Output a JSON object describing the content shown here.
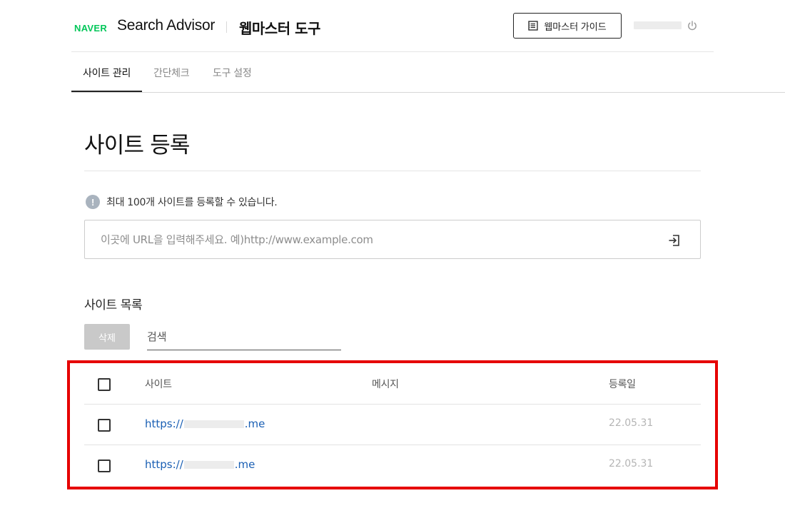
{
  "header": {
    "logo": "NAVER",
    "product": "Search Advisor",
    "subtitle": "웹마스터 도구",
    "guide_button": "웹마스터 가이드"
  },
  "tabs": [
    {
      "label": "사이트 관리",
      "active": true
    },
    {
      "label": "간단체크",
      "active": false
    },
    {
      "label": "도구 설정",
      "active": false
    }
  ],
  "page": {
    "title": "사이트 등록",
    "notice": "최대 100개 사이트를 등록할 수 있습니다.",
    "url_placeholder": "이곳에 URL을 입력해주세요. 예)http://www.example.com"
  },
  "list": {
    "title": "사이트 목록",
    "delete_button": "삭제",
    "search_placeholder": "검색",
    "columns": {
      "site": "사이트",
      "message": "메시지",
      "date": "등록일"
    },
    "rows": [
      {
        "url_prefix": "https://",
        "url_suffix": ".me",
        "message": "",
        "date": "22.05.31"
      },
      {
        "url_prefix": "https://",
        "url_suffix": ".me",
        "message": "",
        "date": "22.05.31"
      }
    ]
  },
  "colors": {
    "brand": "#03c75a",
    "link": "#1a5fb4",
    "highlight": "#e60000"
  },
  "icons": [
    "guide-book-icon",
    "power-icon",
    "info-icon",
    "submit-enter-icon"
  ]
}
